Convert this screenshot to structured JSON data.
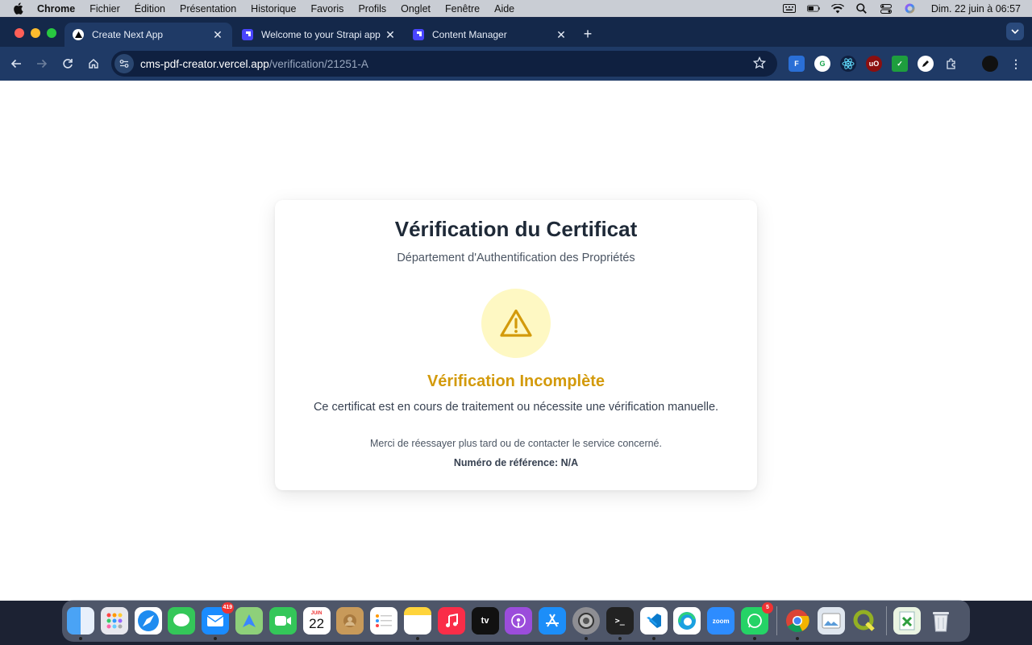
{
  "menubar": {
    "app": "Chrome",
    "items": [
      "Fichier",
      "Édition",
      "Présentation",
      "Historique",
      "Favoris",
      "Profils",
      "Onglet",
      "Fenêtre",
      "Aide"
    ],
    "clock": "Dim. 22 juin à 06:57"
  },
  "tabs": [
    {
      "title": "Create Next App",
      "active": true
    },
    {
      "title": "Welcome to your Strapi app",
      "active": false
    },
    {
      "title": "Content Manager",
      "active": false
    }
  ],
  "omnibox": {
    "host": "cms-pdf-creator.vercel.app",
    "path": "/verification/21251-A"
  },
  "card": {
    "title": "Vérification du Certificat",
    "subtitle": "Département d'Authentification des Propriétés",
    "status_title": "Vérification Incomplète",
    "status_description": "Ce certificat est en cours de traitement ou nécessite une vérification manuelle.",
    "retry_text": "Merci de réessayer plus tard ou de contacter le service concerné.",
    "reference": "Numéro de référence: N/A"
  },
  "colors": {
    "status_accent": "#d39a0b",
    "warning_bg": "#fef8c3",
    "title": "#1e2937",
    "tab_strip": "#14284a"
  },
  "dock": {
    "mail_badge": "419",
    "calendar_month": "JUIN",
    "calendar_day": "22",
    "whatsapp_badge": "5",
    "zoom_label": "zoom",
    "appletv_label": "tv"
  }
}
